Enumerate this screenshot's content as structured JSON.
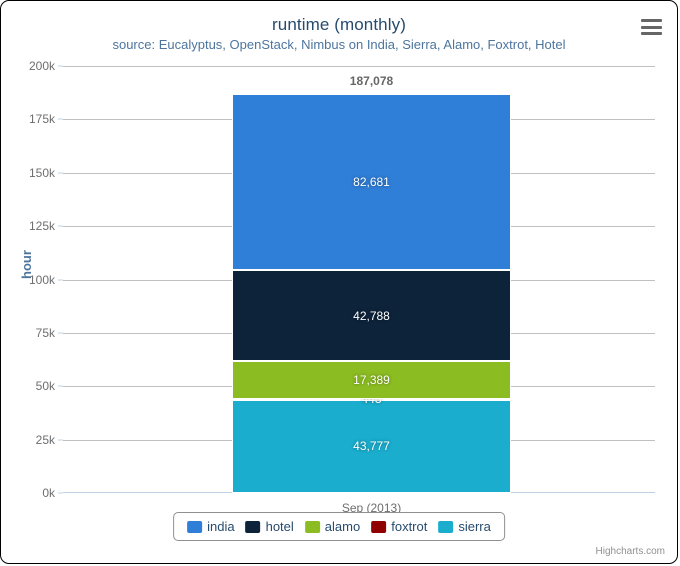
{
  "chart": {
    "title": "runtime (monthly)",
    "subtitle": "source: Eucalyptus, OpenStack, Nimbus on India, Sierra, Alamo, Foxtrot, Hotel",
    "credits": "Highcharts.com",
    "export_icon": "hamburger-menu-icon",
    "background_color": "#ffffff",
    "border_color": "#000000"
  },
  "chart_data": {
    "type": "bar",
    "stacked": true,
    "title": "runtime (monthly)",
    "subtitle": "source: Eucalyptus, OpenStack, Nimbus on India, Sierra, Alamo, Foxtrot, Hotel",
    "xlabel": "",
    "ylabel": "hour",
    "categories": [
      "Sep (2013)"
    ],
    "ylim": [
      0,
      200000
    ],
    "ytick_values": [
      0,
      25000,
      50000,
      75000,
      100000,
      125000,
      150000,
      175000,
      200000
    ],
    "ytick_labels": [
      "0k",
      "25k",
      "50k",
      "75k",
      "100k",
      "125k",
      "150k",
      "175k",
      "200k"
    ],
    "grid": true,
    "legend_position": "bottom",
    "stack_total": 187078,
    "stack_total_label": "187,078",
    "stack_order_bottom_to_top": [
      "sierra",
      "foxtrot",
      "alamo",
      "hotel",
      "india"
    ],
    "series": [
      {
        "name": "india",
        "values": [
          82681
        ],
        "labels": [
          "82,681"
        ],
        "color": "#2f7ed8"
      },
      {
        "name": "hotel",
        "values": [
          42788
        ],
        "labels": [
          "42,788"
        ],
        "color": "#0d233a"
      },
      {
        "name": "alamo",
        "values": [
          17389
        ],
        "labels": [
          "17,389"
        ],
        "color": "#8bbc21"
      },
      {
        "name": "foxtrot",
        "values": [
          443
        ],
        "labels": [
          "443"
        ],
        "color": "#910000"
      },
      {
        "name": "sierra",
        "values": [
          43777
        ],
        "labels": [
          "43,777"
        ],
        "color": "#1aadce"
      }
    ]
  },
  "yaxis": {
    "title": "hour",
    "ticks": [
      {
        "label": "200k",
        "value": 200000
      },
      {
        "label": "175k",
        "value": 175000
      },
      {
        "label": "150k",
        "value": 150000
      },
      {
        "label": "125k",
        "value": 125000
      },
      {
        "label": "100k",
        "value": 100000
      },
      {
        "label": "75k",
        "value": 75000
      },
      {
        "label": "50k",
        "value": 50000
      },
      {
        "label": "25k",
        "value": 25000
      },
      {
        "label": "0k",
        "value": 0
      }
    ]
  },
  "xaxis": {
    "categories": [
      "Sep (2013)"
    ]
  },
  "legend": {
    "items": [
      {
        "label": "india",
        "color": "#2f7ed8"
      },
      {
        "label": "hotel",
        "color": "#0d233a"
      },
      {
        "label": "alamo",
        "color": "#8bbc21"
      },
      {
        "label": "foxtrot",
        "color": "#910000"
      },
      {
        "label": "sierra",
        "color": "#1aadce"
      }
    ]
  }
}
